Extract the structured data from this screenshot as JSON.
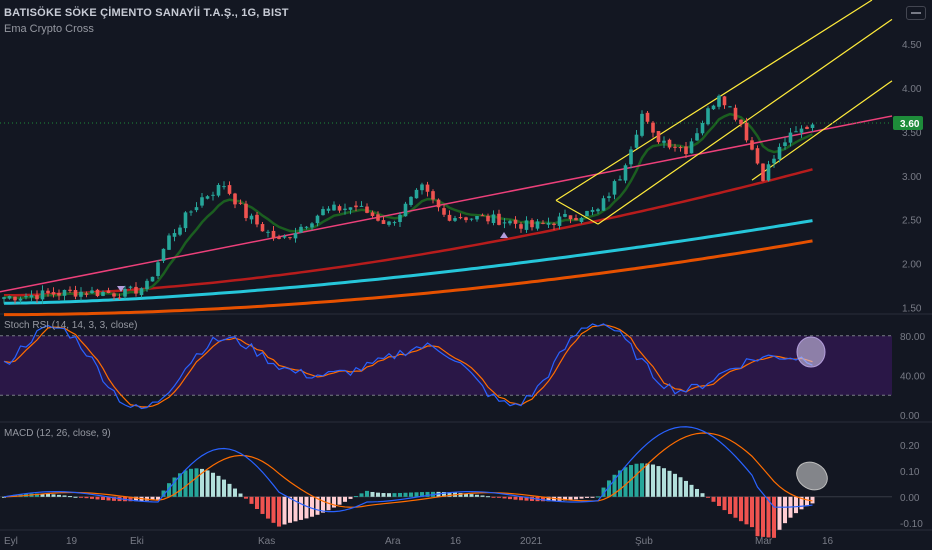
{
  "header": {
    "title": "BATISÖKE SÖKE ÇİMENTO SANAYİİ T.A.Ş., 1G, BIST",
    "indicator": "Ema Crypto Cross"
  },
  "colors": {
    "background": "#131722",
    "up": "#26a69a",
    "down": "#ef5350",
    "ema_fast": "#1b5e20",
    "ema_mid": "#b71c1c",
    "ema_slow": "#26c6da",
    "ema_slower": "#e65100",
    "trendline": "#ec407a",
    "channel": "#ffeb3b",
    "stoch_band": "#2a1747",
    "stoch_k": "#2962ff",
    "stoch_d": "#ff6d00",
    "price_tag": "#1e8c3a"
  },
  "price_axis": {
    "ticks": [
      "4.50",
      "4.00",
      "3.50",
      "3.00",
      "2.50",
      "2.00",
      "1.50"
    ],
    "current_price": "3.60"
  },
  "stoch": {
    "label": "Stoch RSI (14, 14, 3, 3, close)",
    "ticks": [
      "80.00",
      "40.00",
      "0.00"
    ]
  },
  "macd": {
    "label": "MACD (12, 26, close, 9)",
    "ticks": [
      "0.20",
      "0.10",
      "0.00",
      "-0.10"
    ]
  },
  "time_axis": {
    "labels": [
      "Eyl",
      "19",
      "Eki",
      "Kas",
      "Ara",
      "16",
      "2021",
      "Şub",
      "Mar",
      "16"
    ]
  },
  "chart_data": {
    "type": "candlestick",
    "pane_main": {
      "ylim": [
        1.45,
        5.0
      ],
      "series": [
        {
          "name": "price"
        }
      ]
    },
    "pane_stoch": {
      "ylim": [
        -5,
        100
      ]
    },
    "pane_macd": {
      "ylim": [
        -0.12,
        0.28
      ]
    }
  }
}
